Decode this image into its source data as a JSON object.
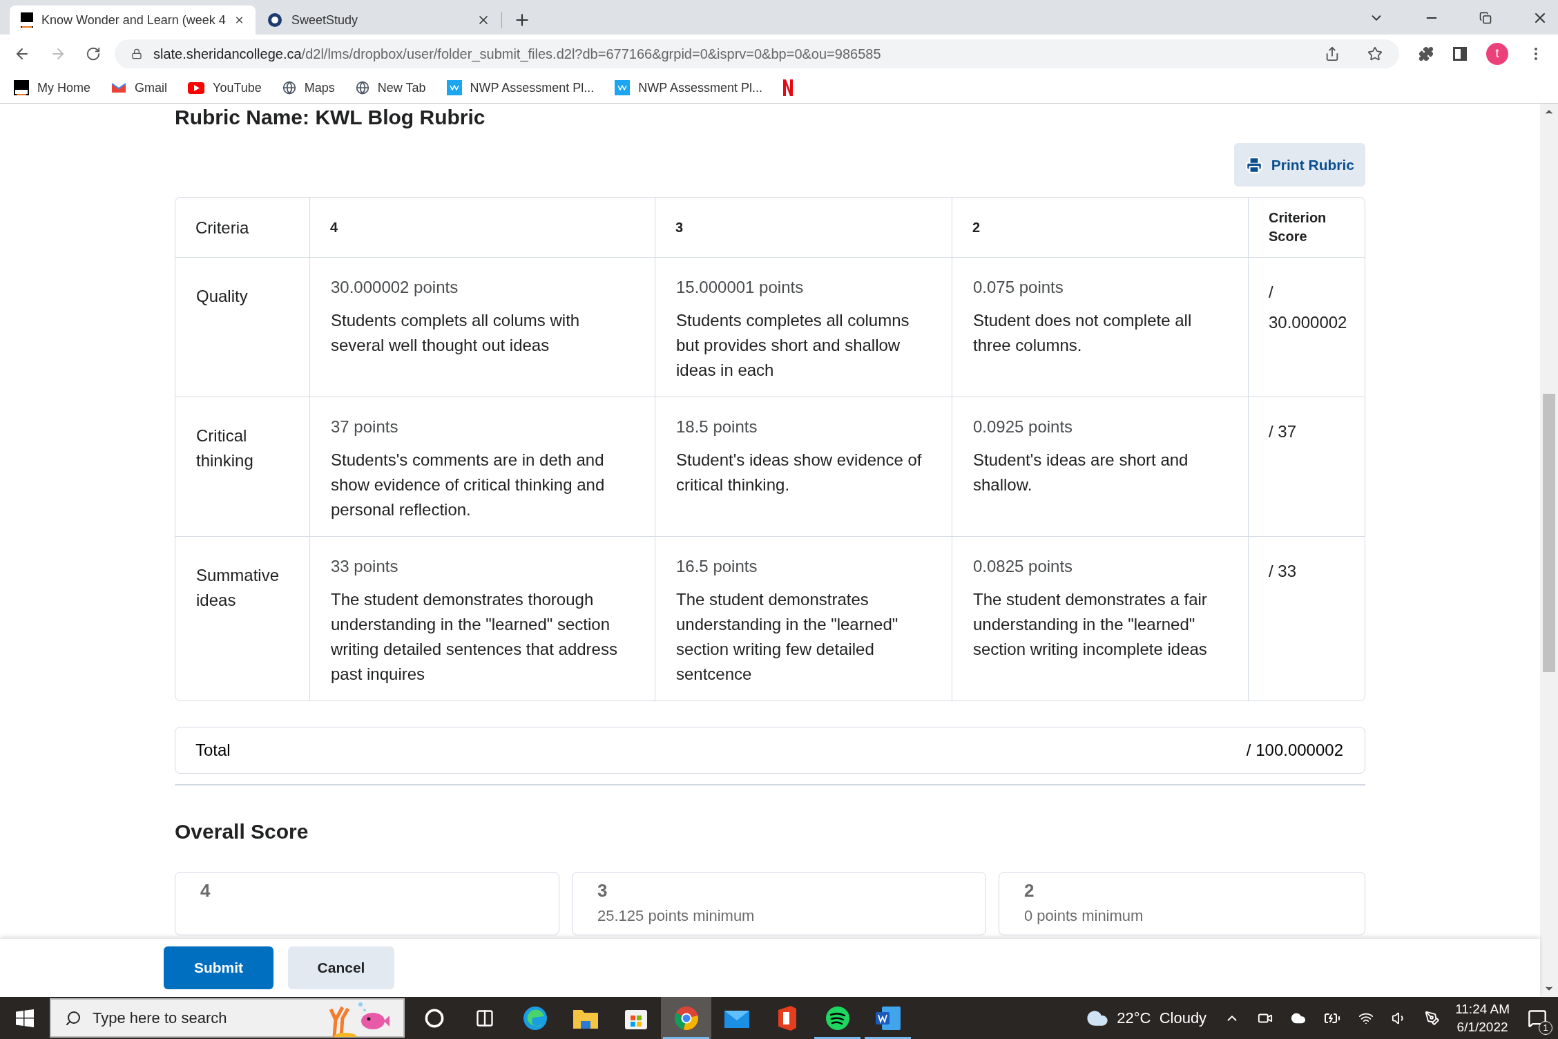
{
  "browser": {
    "tabs": [
      {
        "title": "Know Wonder and Learn (week 4",
        "kind": "d2l",
        "selected": true
      },
      {
        "title": "SweetStudy",
        "kind": "sweetstudy",
        "selected": false
      }
    ],
    "url_host": "slate.sheridancollege.ca",
    "url_path": "/d2l/lms/dropbox/user/folder_submit_files.d2l?db=677166&grpid=0&isprv=0&bp=0&ou=986585",
    "profile_initial": "t",
    "bookmarks": [
      {
        "label": "My Home",
        "kind": "d2l"
      },
      {
        "label": "Gmail",
        "kind": "gmail"
      },
      {
        "label": "YouTube",
        "kind": "youtube"
      },
      {
        "label": "Maps",
        "kind": "globe"
      },
      {
        "label": "New Tab",
        "kind": "globe"
      },
      {
        "label": "NWP Assessment Pl...",
        "kind": "wp"
      },
      {
        "label": "NWP Assessment Pl...",
        "kind": "wp"
      },
      {
        "kind": "netflix"
      }
    ]
  },
  "page": {
    "rubric_title": "Rubric Name: KWL Blog Rubric",
    "print_button": "Print Rubric",
    "table": {
      "columns": [
        "Criteria",
        "4",
        "3",
        "2",
        "Criterion Score"
      ],
      "rows": [
        {
          "cells": [
            {
              "text": "Quality"
            },
            {
              "points": "30.000002 points",
              "description": "Students complets all colums with several well thought out ideas"
            },
            {
              "points": "15.000001 points",
              "description": "Students completes all columns but provides short and shallow ideas in each"
            },
            {
              "points": "0.075 points",
              "description": "Student does not complete all three columns."
            },
            {
              "text": "/ 30.000002"
            }
          ]
        },
        {
          "cells": [
            {
              "text": "Critical thinking"
            },
            {
              "points": "37 points",
              "description": "Students's comments are in deth and show evidence of critical thinking and personal reflection."
            },
            {
              "points": "18.5 points",
              "description": "Student's ideas show evidence of critical thinking."
            },
            {
              "points": "0.0925 points",
              "description": "Student's ideas are short and shallow."
            },
            {
              "text": "/ 37"
            }
          ]
        },
        {
          "cells": [
            {
              "text": "Summative ideas"
            },
            {
              "points": "33 points",
              "description": "The student demonstrates thorough understanding in the \"learned\" section writing detailed sentences that address past inquires"
            },
            {
              "points": "16.5 points",
              "description": "The student demonstrates understanding in the \"learned\" section writing few detailed sentcence"
            },
            {
              "points": "0.0825 points",
              "description": "The student demonstrates a fair understanding in the \"learned\" section writing incomplete ideas"
            },
            {
              "text": "/ 33"
            }
          ]
        }
      ]
    },
    "total": {
      "label": "Total",
      "value": "/ 100.000002"
    },
    "overall_score": {
      "title": "Overall Score",
      "cards": [
        {
          "level": "4"
        },
        {
          "level": "3",
          "minimum": "25.125 points minimum"
        },
        {
          "level": "2",
          "minimum": "0 points minimum"
        }
      ]
    },
    "buttons": [
      {
        "label": "Submit",
        "kind": "primary"
      },
      {
        "label": "Cancel",
        "kind": "secondary"
      }
    ]
  },
  "taskbar": {
    "search_placeholder": "Type here to search",
    "apps": [
      {
        "kind": "cortana",
        "selected": false,
        "running": false
      },
      {
        "kind": "taskview",
        "selected": false,
        "running": false
      },
      {
        "kind": "edge",
        "selected": false,
        "running": false
      },
      {
        "kind": "explorer",
        "selected": false,
        "running": false
      },
      {
        "kind": "store",
        "selected": false,
        "running": false
      },
      {
        "kind": "chrome",
        "selected": true,
        "running": true
      },
      {
        "kind": "mail",
        "selected": false,
        "running": false
      },
      {
        "kind": "office",
        "selected": false,
        "running": false
      },
      {
        "kind": "spotify",
        "selected": false,
        "running": true
      },
      {
        "kind": "word",
        "selected": false,
        "running": true
      }
    ],
    "weather": {
      "temperature": "22°C",
      "condition": "Cloudy"
    },
    "time": "11:24 AM",
    "date": "6/1/2022",
    "notifications": "1"
  }
}
